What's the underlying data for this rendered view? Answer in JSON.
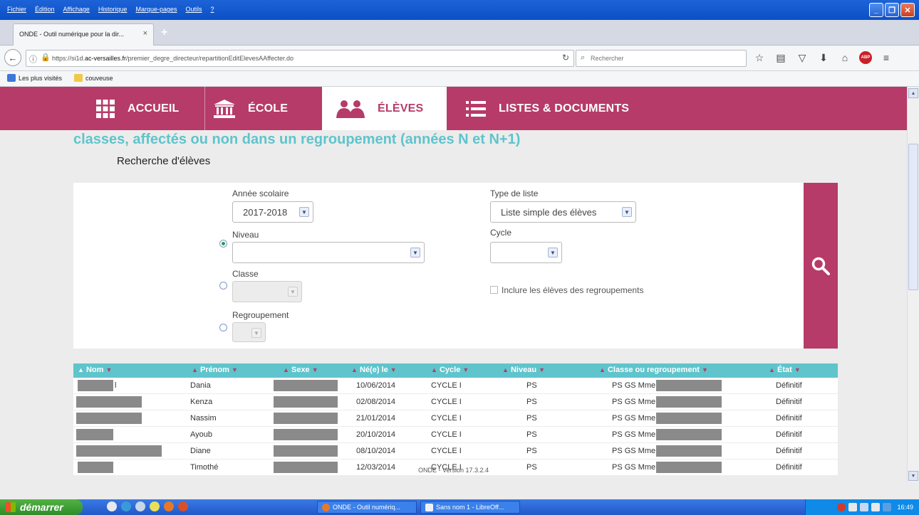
{
  "browser": {
    "menus": [
      "Fichier",
      "Édition",
      "Affichage",
      "Historique",
      "Marque-pages",
      "Outils",
      "?"
    ],
    "tab": {
      "title": "ONDE - Outil numérique pour la dir...",
      "close": "×",
      "new": "+"
    },
    "url_prefix": "https://si1d.",
    "url_domain": "ac-versailles.fr",
    "url_path": "/premier_degre_directeur/repartitionEditElevesAAffecter.do",
    "search_placeholder": "Rechercher",
    "bookmarks": [
      "Les plus visités",
      "couveuse"
    ],
    "adblock": "ABP"
  },
  "nav": {
    "items": [
      {
        "label": "ACCUEIL",
        "icon": "grid-icon"
      },
      {
        "label": "ÉCOLE",
        "icon": "school-building-icon"
      },
      {
        "label": "ÉLÈVES",
        "icon": "students-icon",
        "active": true
      },
      {
        "label": "LISTES & DOCUMENTS",
        "icon": "list-icon"
      }
    ]
  },
  "page": {
    "heading": "classes, affectés ou non dans un regroupement (années N et N+1)",
    "subheading": "Recherche d'élèves"
  },
  "form": {
    "annee_label": "Année scolaire",
    "annee_value": "2017-2018",
    "niveau_label": "Niveau",
    "niveau_value": "",
    "classe_label": "Classe",
    "regroupement_label": "Regroupement",
    "type_label": "Type de liste",
    "type_value": "Liste simple des élèves",
    "cycle_label": "Cycle",
    "cycle_value": "",
    "include_label": "Inclure les élèves des regroupements",
    "selected_radio": "niveau"
  },
  "table": {
    "columns": [
      "Nom",
      "Prénom",
      "Sexe",
      "Né(e) le",
      "Cycle",
      "Niveau",
      "Classe ou regroupement",
      "État"
    ],
    "rows": [
      {
        "nom_suffix": "l",
        "prenom": "Dania",
        "date": "10/06/2014",
        "cycle": "CYCLE I",
        "niveau": "PS",
        "classe": "PS GS Mme",
        "etat": "Définitif"
      },
      {
        "nom_suffix": "",
        "prenom": "Kenza",
        "date": "02/08/2014",
        "cycle": "CYCLE I",
        "niveau": "PS",
        "classe": "PS GS Mme",
        "etat": "Définitif"
      },
      {
        "nom_suffix": "",
        "prenom": "Nassim",
        "date": "21/01/2014",
        "cycle": "CYCLE I",
        "niveau": "PS",
        "classe": "PS GS Mme",
        "etat": "Définitif"
      },
      {
        "nom_suffix": "",
        "prenom": "Ayoub",
        "date": "20/10/2014",
        "cycle": "CYCLE I",
        "niveau": "PS",
        "classe": "PS GS Mme",
        "etat": "Définitif"
      },
      {
        "nom_suffix": "",
        "prenom": "Diane",
        "date": "08/10/2014",
        "cycle": "CYCLE I",
        "niveau": "PS",
        "classe": "PS GS Mme",
        "etat": "Définitif"
      },
      {
        "nom_suffix": "",
        "prenom": "Timothé",
        "date": "12/03/2014",
        "cycle": "CYCLE I",
        "niveau": "PS",
        "classe": "PS GS Mme",
        "etat": "Définitif"
      }
    ]
  },
  "footer": {
    "version": "ONDE - Version 17.3.2.4"
  },
  "taskbar": {
    "start": "démarrer",
    "tasks": [
      "ONDE - Outil numériq...",
      "Sans nom 1 - LibreOff..."
    ],
    "clock": "16:49"
  },
  "colors": {
    "brand": "#b63b68",
    "accent": "#5fc4cc"
  }
}
